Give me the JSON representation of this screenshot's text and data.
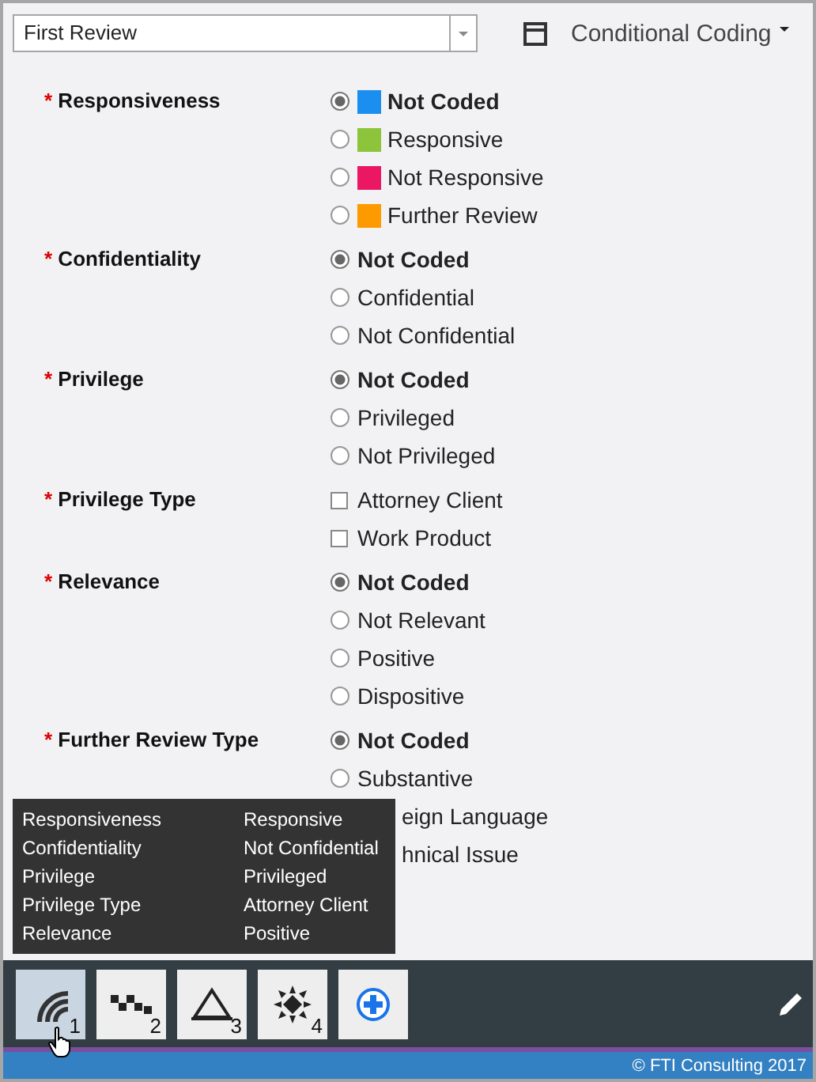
{
  "header": {
    "review_select": {
      "value": "First Review"
    },
    "layout_title": "Conditional Coding"
  },
  "fields": [
    {
      "label": "Responsiveness",
      "required_mark": "*",
      "kind": "radio",
      "options": [
        {
          "kind": "full",
          "label": "Not Coded",
          "selected": true,
          "color": "#1a8ff0"
        },
        {
          "kind": "full",
          "label": "Responsive",
          "selected": false,
          "color": "#8cc43c"
        },
        {
          "kind": "full",
          "label": "Not Responsive",
          "selected": false,
          "color": "#ec1763"
        },
        {
          "kind": "full",
          "label": "Further Review",
          "selected": false,
          "color": "#fd9a00"
        }
      ]
    },
    {
      "label": "Confidentiality",
      "required_mark": "*",
      "kind": "radio",
      "options": [
        {
          "kind": "full",
          "label": "Not Coded",
          "selected": true
        },
        {
          "kind": "full",
          "label": "Confidential",
          "selected": false
        },
        {
          "kind": "full",
          "label": "Not Confidential",
          "selected": false
        }
      ]
    },
    {
      "label": "Privilege",
      "required_mark": "*",
      "kind": "radio",
      "options": [
        {
          "kind": "full",
          "label": "Not Coded",
          "selected": true
        },
        {
          "kind": "full",
          "label": "Privileged",
          "selected": false
        },
        {
          "kind": "full",
          "label": "Not Privileged",
          "selected": false
        }
      ]
    },
    {
      "label": "Privilege Type",
      "required_mark": "*",
      "kind": "checkbox",
      "options": [
        {
          "kind": "full",
          "label": "Attorney Client",
          "checked": false
        },
        {
          "kind": "full",
          "label": "Work Product",
          "checked": false
        }
      ]
    },
    {
      "label": "Relevance",
      "required_mark": "*",
      "kind": "radio",
      "options": [
        {
          "kind": "full",
          "label": "Not Coded",
          "selected": true
        },
        {
          "kind": "full",
          "label": "Not Relevant",
          "selected": false
        },
        {
          "kind": "full",
          "label": "Positive",
          "selected": false
        },
        {
          "kind": "full",
          "label": "Dispositive",
          "selected": false
        }
      ]
    },
    {
      "label": "Further Review Type",
      "required_mark": "*",
      "kind": "radio",
      "options": [
        {
          "kind": "full",
          "label": "Not Coded",
          "selected": true
        },
        {
          "kind": "full",
          "label": "Substantive",
          "selected": false
        },
        {
          "kind": "partial",
          "label": "eign Language"
        },
        {
          "kind": "partial",
          "label": "hnical Issue"
        }
      ]
    }
  ],
  "tooltip": {
    "rows": [
      {
        "field": "Responsiveness",
        "value": "Responsive"
      },
      {
        "field": "Confidentiality",
        "value": "Not Confidential"
      },
      {
        "field": "Privilege",
        "value": "Privileged"
      },
      {
        "field": "Privilege Type",
        "value": "Attorney Client"
      },
      {
        "field": "Relevance",
        "value": "Positive"
      }
    ]
  },
  "toolbar": {
    "buttons": [
      {
        "kind": "arcs",
        "number": "1",
        "selected": true
      },
      {
        "kind": "checker",
        "number": "2",
        "selected": false
      },
      {
        "kind": "triangle",
        "number": "3",
        "selected": false
      },
      {
        "kind": "star",
        "number": "4",
        "selected": false
      },
      {
        "kind": "add",
        "selected": false
      }
    ]
  },
  "footer": "© FTI Consulting 2017"
}
